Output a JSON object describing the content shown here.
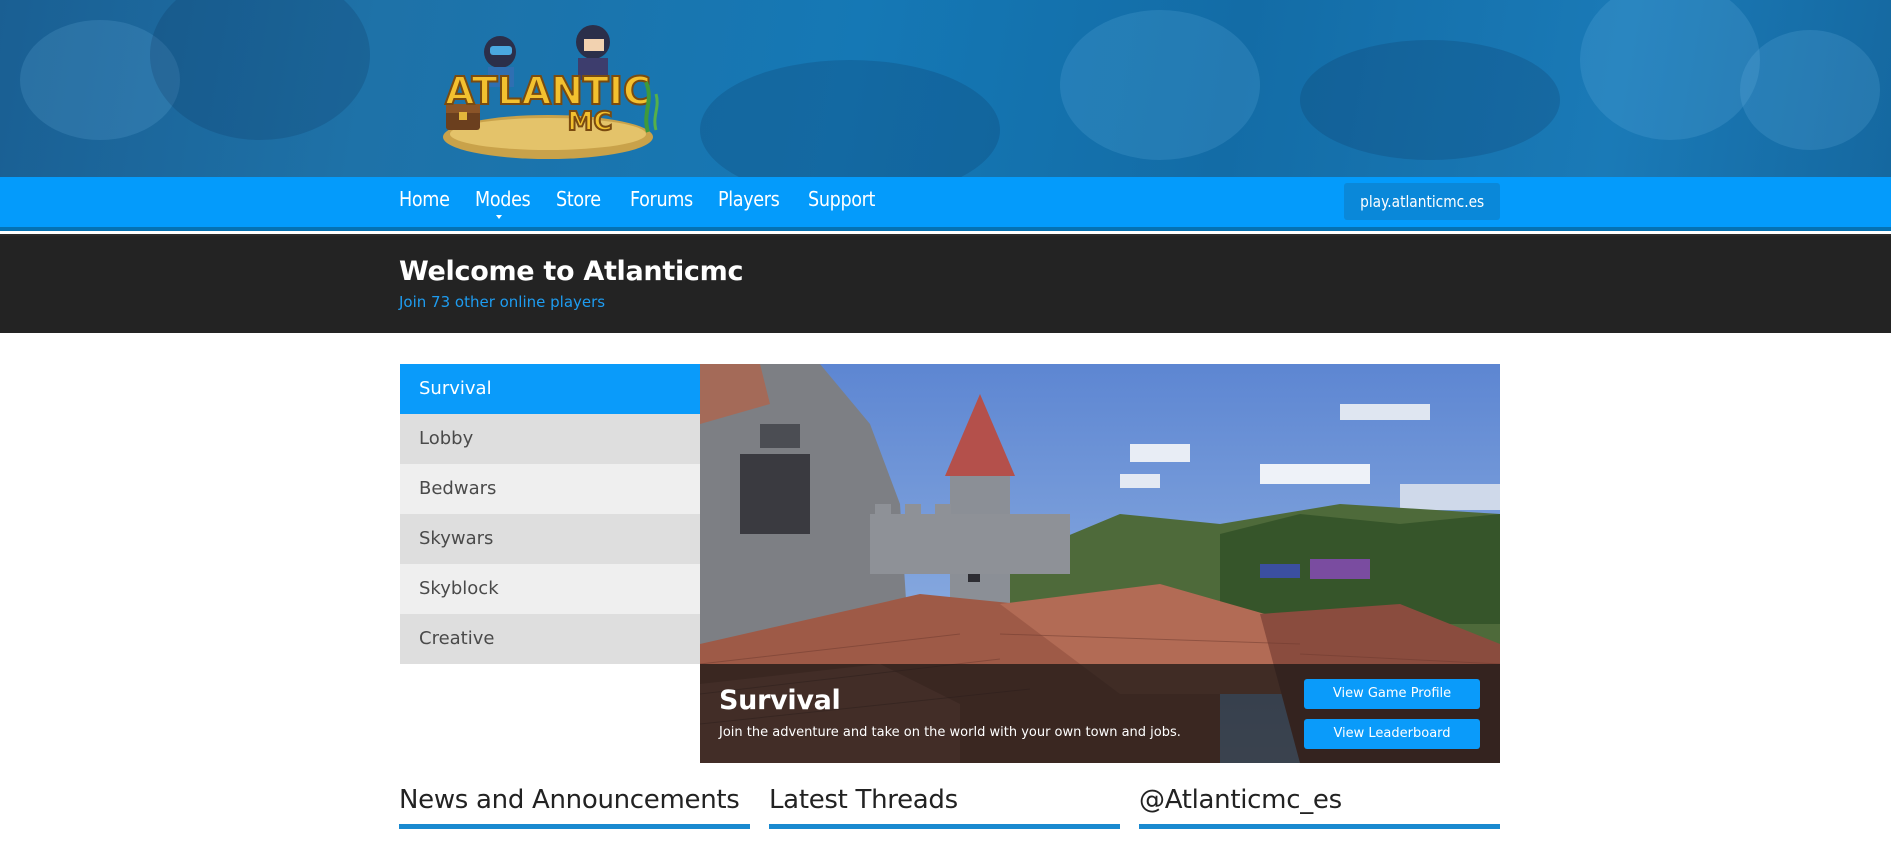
{
  "brand": {
    "logo_text_line1": "ATLANTIC",
    "logo_text_line2": "MC",
    "logo_icon": "atlanticmc-logo-icon"
  },
  "nav": {
    "items": [
      {
        "label": "Home"
      },
      {
        "label": "Modes"
      },
      {
        "label": "Store"
      },
      {
        "label": "Forums"
      },
      {
        "label": "Players"
      },
      {
        "label": "Support"
      }
    ],
    "server_ip": "play.atlanticmc.es"
  },
  "welcome": {
    "title": "Welcome to Atlanticmc",
    "subtitle": "Join 73 other online players"
  },
  "modes": {
    "items": [
      {
        "label": "Survival"
      },
      {
        "label": "Lobby"
      },
      {
        "label": "Bedwars"
      },
      {
        "label": "Skywars"
      },
      {
        "label": "Skyblock"
      },
      {
        "label": "Creative"
      }
    ],
    "active": "Survival"
  },
  "featured": {
    "title": "Survival",
    "description": "Join the adventure and take on the world with your own town and jobs.",
    "primary_button": "View Game Profile",
    "secondary_button": "View Leaderboard"
  },
  "sections": [
    {
      "title": "News and Announcements"
    },
    {
      "title": "Latest Threads"
    },
    {
      "title": "@Atlanticmc_es"
    }
  ],
  "colors": {
    "nav_blue": "#049bfb",
    "accent_blue": "#0a9bfa",
    "dark_band": "#232323",
    "link_blue": "#1e9cf0"
  }
}
